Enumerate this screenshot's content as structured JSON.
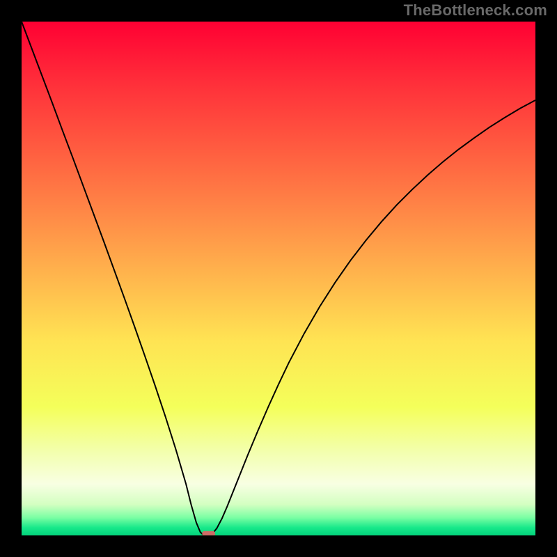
{
  "watermark": "TheBottleneck.com",
  "chart_data": {
    "type": "line",
    "title": "",
    "xlabel": "",
    "ylabel": "",
    "xlim": [
      0,
      100
    ],
    "ylim": [
      0,
      100
    ],
    "grid": false,
    "legend": false,
    "background_gradient": {
      "orientation": "vertical",
      "stops": [
        {
          "pos": 0.0,
          "color": "#ff0033"
        },
        {
          "pos": 0.12,
          "color": "#ff2f3a"
        },
        {
          "pos": 0.25,
          "color": "#ff5d40"
        },
        {
          "pos": 0.38,
          "color": "#ff8b47"
        },
        {
          "pos": 0.5,
          "color": "#ffb74d"
        },
        {
          "pos": 0.62,
          "color": "#ffe353"
        },
        {
          "pos": 0.75,
          "color": "#f4ff5a"
        },
        {
          "pos": 0.84,
          "color": "#f3ffb0"
        },
        {
          "pos": 0.9,
          "color": "#f8ffe3"
        },
        {
          "pos": 0.94,
          "color": "#d3ffc1"
        },
        {
          "pos": 0.965,
          "color": "#7cffa4"
        },
        {
          "pos": 0.985,
          "color": "#17e88a"
        },
        {
          "pos": 1.0,
          "color": "#03d47c"
        }
      ]
    },
    "series": [
      {
        "name": "bottleneck-curve",
        "stroke": "#000000",
        "stroke_width": 2,
        "points": [
          {
            "x": 0.0,
            "y": 100.0
          },
          {
            "x": 2.0,
            "y": 94.7
          },
          {
            "x": 4.0,
            "y": 89.4
          },
          {
            "x": 6.0,
            "y": 84.1
          },
          {
            "x": 8.0,
            "y": 78.7
          },
          {
            "x": 10.0,
            "y": 73.4
          },
          {
            "x": 12.0,
            "y": 68.0
          },
          {
            "x": 14.0,
            "y": 62.6
          },
          {
            "x": 16.0,
            "y": 57.2
          },
          {
            "x": 18.0,
            "y": 51.7
          },
          {
            "x": 20.0,
            "y": 46.2
          },
          {
            "x": 22.0,
            "y": 40.6
          },
          {
            "x": 24.0,
            "y": 34.9
          },
          {
            "x": 26.0,
            "y": 29.1
          },
          {
            "x": 28.0,
            "y": 23.1
          },
          {
            "x": 30.0,
            "y": 16.8
          },
          {
            "x": 32.0,
            "y": 10.0
          },
          {
            "x": 33.0,
            "y": 6.0
          },
          {
            "x": 34.0,
            "y": 2.5
          },
          {
            "x": 34.8,
            "y": 0.6
          },
          {
            "x": 35.5,
            "y": 0.0
          },
          {
            "x": 36.5,
            "y": 0.0
          },
          {
            "x": 37.2,
            "y": 0.4
          },
          {
            "x": 38.0,
            "y": 1.4
          },
          {
            "x": 39.0,
            "y": 3.3
          },
          {
            "x": 40.0,
            "y": 5.6
          },
          {
            "x": 42.0,
            "y": 10.6
          },
          {
            "x": 44.0,
            "y": 15.6
          },
          {
            "x": 46.0,
            "y": 20.4
          },
          {
            "x": 48.0,
            "y": 25.0
          },
          {
            "x": 50.0,
            "y": 29.4
          },
          {
            "x": 52.0,
            "y": 33.6
          },
          {
            "x": 55.0,
            "y": 39.3
          },
          {
            "x": 58.0,
            "y": 44.5
          },
          {
            "x": 61.0,
            "y": 49.2
          },
          {
            "x": 64.0,
            "y": 53.5
          },
          {
            "x": 67.0,
            "y": 57.4
          },
          {
            "x": 70.0,
            "y": 61.0
          },
          {
            "x": 73.0,
            "y": 64.3
          },
          {
            "x": 76.0,
            "y": 67.3
          },
          {
            "x": 79.0,
            "y": 70.1
          },
          {
            "x": 82.0,
            "y": 72.7
          },
          {
            "x": 85.0,
            "y": 75.1
          },
          {
            "x": 88.0,
            "y": 77.3
          },
          {
            "x": 91.0,
            "y": 79.4
          },
          {
            "x": 94.0,
            "y": 81.3
          },
          {
            "x": 97.0,
            "y": 83.1
          },
          {
            "x": 100.0,
            "y": 84.7
          }
        ]
      }
    ],
    "markers": [
      {
        "name": "optimal-point",
        "shape": "rounded-rect",
        "cx": 36.4,
        "cy": 0.35,
        "width_units": 2.5,
        "height_units": 1.0,
        "fill": "#cc6b66"
      }
    ]
  }
}
